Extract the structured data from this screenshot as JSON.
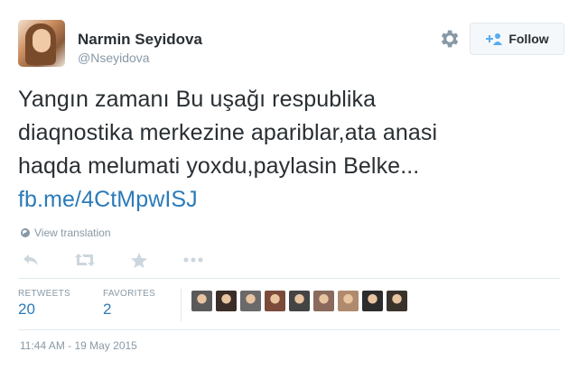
{
  "author": {
    "name": "Narmin Seyidova",
    "handle": "@Nseyidova"
  },
  "follow_button": {
    "label": "Follow"
  },
  "tweet": {
    "lines": [
      "Yangın zamanı Bu uşağı respublika",
      "diaqnostika merkezine apariblar,ata anasi",
      "haqda melumati yoxdu,paylasin Belke..."
    ],
    "link": "fb.me/4CtMpwISJ",
    "view_translation": "View translation"
  },
  "actions": [
    {
      "icon": "reply-icon"
    },
    {
      "icon": "retweet-icon"
    },
    {
      "icon": "favorite-star-icon"
    },
    {
      "icon": "more-icon"
    }
  ],
  "stats": {
    "retweets_label": "RETWEETS",
    "retweets_count": "20",
    "favorites_label": "FAVORITES",
    "favorites_count": "2"
  },
  "favoriter_avatars": [
    {
      "color": "#5a5a5a"
    },
    {
      "color": "#3b2d28"
    },
    {
      "color": "#6a6a6a"
    },
    {
      "color": "#7b4a3a"
    },
    {
      "color": "#444444"
    },
    {
      "color": "#8a6a5c"
    },
    {
      "color": "#b08a6e"
    },
    {
      "color": "#2c2c2c"
    },
    {
      "color": "#3a332c"
    }
  ],
  "timestamp": "11:44 AM - 19 May 2015",
  "colors": {
    "link": "#2b7bb9",
    "muted": "#8899a6",
    "text": "#292f33"
  }
}
